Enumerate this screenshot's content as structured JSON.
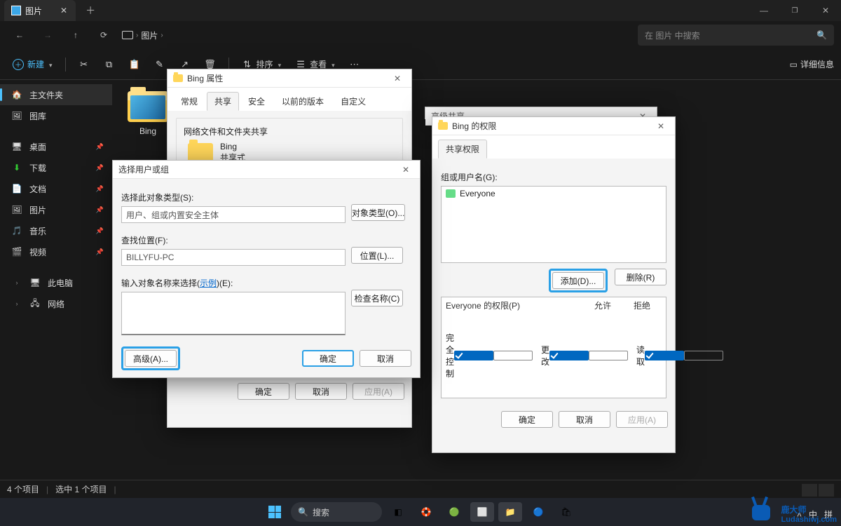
{
  "explorer": {
    "tab_title": "图片",
    "path_segment": "图片",
    "search_placeholder": "在 图片 中搜索",
    "new_button": "新建",
    "sort_button": "排序",
    "view_button": "查看",
    "details_button": "详细信息",
    "sidebar": {
      "home": "主文件夹",
      "gallery": "图库",
      "desktop": "桌面",
      "downloads": "下载",
      "documents": "文档",
      "pictures": "图片",
      "music": "音乐",
      "videos": "视频",
      "thispc": "此电脑",
      "network": "网络"
    },
    "folder_name": "Bing",
    "status_count": "4 个项目",
    "status_sel": "选中 1 个项目"
  },
  "props_dialog": {
    "title": "Bing 属性",
    "tabs": {
      "general": "常规",
      "sharing": "共享",
      "security": "安全",
      "previous": "以前的版本",
      "custom": "自定义"
    },
    "share_heading": "网络文件和文件夹共享",
    "folder_name": "Bing",
    "share_mode": "共享式",
    "ok": "确定",
    "cancel": "取消",
    "apply": "应用(A)"
  },
  "select_dialog": {
    "title": "选择用户或组",
    "obj_type_label": "选择此对象类型(S):",
    "obj_type_value": "用户、组或内置安全主体",
    "obj_type_btn": "对象类型(O)...",
    "location_label": "查找位置(F):",
    "location_value": "BILLYFU-PC",
    "location_btn": "位置(L)...",
    "names_label_prefix": "输入对象名称来选择(",
    "names_label_link": "示例",
    "names_label_suffix": ")(E):",
    "check_btn": "检查名称(C)",
    "advanced_btn": "高级(A)...",
    "ok": "确定",
    "cancel": "取消"
  },
  "adv_share": {
    "title": "高级共享"
  },
  "perm_dialog": {
    "title": "Bing 的权限",
    "tab": "共享权限",
    "group_label": "组或用户名(G):",
    "entries": [
      "Everyone"
    ],
    "add_btn": "添加(D)...",
    "remove_btn": "删除(R)",
    "perm_for_label_prefix": "Everyone 的权限(P)",
    "col_allow": "允许",
    "col_deny": "拒绝",
    "rows": [
      {
        "name": "完全控制",
        "allow": true,
        "deny": false
      },
      {
        "name": "更改",
        "allow": true,
        "deny": false
      },
      {
        "name": "读取",
        "allow": true,
        "deny": false
      }
    ],
    "ok": "确定",
    "cancel": "取消",
    "apply": "应用(A)"
  },
  "taskbar": {
    "search": "搜索",
    "ime_lang": "中",
    "ime_mode": "拼"
  },
  "watermark": {
    "brand": "鹿大师",
    "url": "Ludashiwj.com"
  }
}
